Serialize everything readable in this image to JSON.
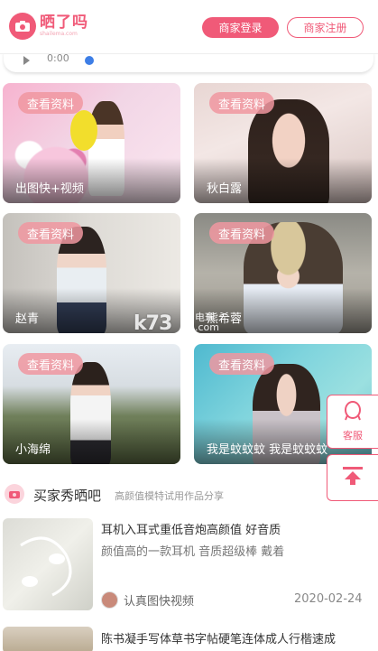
{
  "header": {
    "logo_title": "晒了吗",
    "logo_subtitle": "shailema.com",
    "login_label": "商家登录",
    "register_label": "商家注册"
  },
  "audio": {
    "time": "0:00"
  },
  "cards": [
    {
      "tag": "查看资料",
      "name": "出图快+视频"
    },
    {
      "tag": "查看资料",
      "name": "秋白露"
    },
    {
      "tag": "查看资料",
      "name": "赵青"
    },
    {
      "tag": "查看资料",
      "name": "熊希蓉"
    },
    {
      "tag": "查看资料",
      "name": "小海绵"
    },
    {
      "tag": "查看资料",
      "name": "我是蚊蚊蚊 我是蚊蚊蚊"
    }
  ],
  "watermark": {
    "text": "k73",
    "sub1": "电玩",
    "sub2": ".com"
  },
  "float": {
    "service_label": "客服"
  },
  "section": {
    "title": "买家秀晒吧",
    "subtitle": "高颜值模特试用作品分享"
  },
  "posts": [
    {
      "title": "耳机入耳式重低音炮高颜值 好音质",
      "desc": "颜值高的一款耳机 音质超级棒 戴着",
      "author": "认真图快视频",
      "date": "2020-02-24"
    },
    {
      "title": "陈书凝手写体草书字帖硬笔连体成人行楷速成",
      "desc": "",
      "author": "",
      "date": ""
    }
  ],
  "colors": {
    "accent": "#f05a78"
  }
}
